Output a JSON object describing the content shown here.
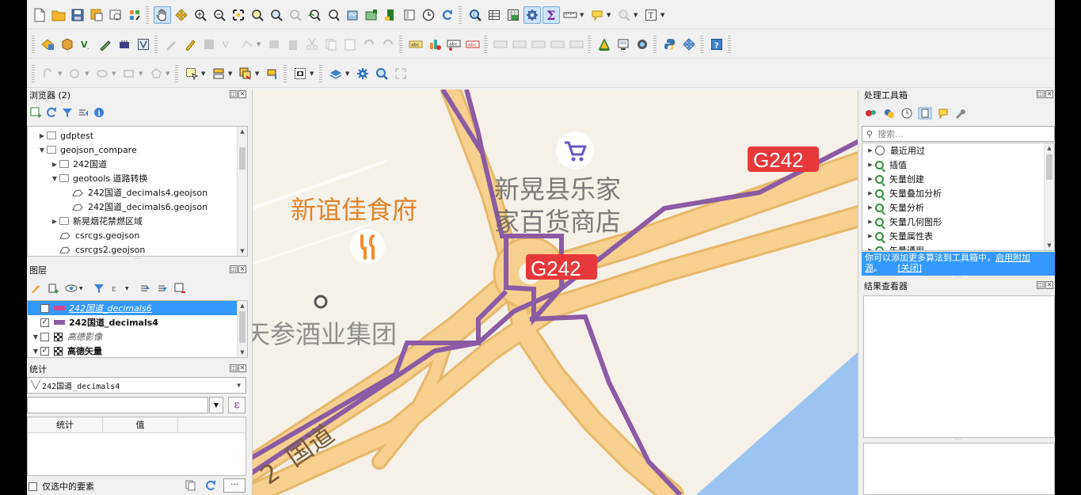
{
  "colors": {
    "accent": "#3399ff",
    "map_background": "#f5f1e8",
    "road": "#f3c985",
    "road_casing": "#e8b86a",
    "route": "#8c5ba3",
    "water": "#9cc4f2",
    "shield_red": "#e8393a",
    "poi_purple": "#6a55c8",
    "poi_orange": "#f28c28"
  },
  "toolbar_icons": {
    "row1": [
      "new-project-icon",
      "open-project-icon",
      "save-project-icon",
      "save-as-icon",
      "print-layout-icon",
      "style-manager-icon",
      "pan-icon",
      "pan-to-selection-icon",
      "zoom-in-icon",
      "zoom-out-icon",
      "zoom-full-icon",
      "zoom-to-selection-icon",
      "zoom-to-layer-icon",
      "zoom-native-icon",
      "zoom-last-icon",
      "zoom-next-icon",
      "new-bookmark-icon",
      "show-bookmarks-icon",
      "temporal-controller-icon",
      "new-map-view-icon",
      "time-icon",
      "refresh-icon",
      "identify-icon",
      "attribute-table-icon",
      "field-calculator-icon",
      "processing-toolbox-icon",
      "statistics-icon",
      "measure-icon",
      "annotation-icon",
      "map-tips-icon",
      "text-annotation-icon"
    ],
    "row2": [
      "data-source-manager-icon",
      "new-geopackage-icon",
      "new-shapefile-icon",
      "digitize-icon",
      "gps-icon",
      "virtual-layer-icon",
      "current-edits-icon",
      "toggle-editing-icon",
      "save-edits-icon",
      "add-feature-icon",
      "vertex-tool-icon",
      "modify-attributes-icon",
      "delete-selected-icon",
      "cut-icon",
      "copy-icon",
      "paste-icon",
      "undo-icon",
      "redo-icon",
      "label-icon",
      "diagram-icon",
      "pin-label-icon",
      "highlight-label-icon",
      "move-label-icon",
      "rotate-label-icon",
      "change-label-icon",
      "show-hide-labels-icon",
      "label-settings-icon",
      "georeferencer-icon",
      "metasearch-icon",
      "globe-icon",
      "python-console-icon",
      "plugin-icon",
      "help-icon"
    ],
    "row3": [
      "digitize-shape-icon",
      "add-circle-icon",
      "add-ellipse-icon",
      "add-rectangle-icon",
      "add-polygon-icon",
      "select-features-icon",
      "select-by-value-icon",
      "deselect-icon",
      "select-by-expression-icon",
      "screenshot-icon",
      "layer-style-icon",
      "settings-gear-icon",
      "locator-search-icon",
      "fullscreen-icon"
    ]
  },
  "browser": {
    "title": "浏览器 (2)",
    "items": [
      {
        "label": "gdptest",
        "type": "folder",
        "indent": 1,
        "expanded": false
      },
      {
        "label": "geojson_compare",
        "type": "folder",
        "indent": 1,
        "expanded": true
      },
      {
        "label": "242国道",
        "type": "folder",
        "indent": 2,
        "expanded": false
      },
      {
        "label": "geotools 道路转换",
        "type": "folder",
        "indent": 2,
        "expanded": true
      },
      {
        "label": "242国道_decimals4.geojson",
        "type": "geojson",
        "indent": 3
      },
      {
        "label": "242国道_decimals6.geojson",
        "type": "geojson",
        "indent": 3
      },
      {
        "label": "新晃烟花禁燃区域",
        "type": "folder",
        "indent": 2,
        "expanded": false
      },
      {
        "label": "csrcgs.geojson",
        "type": "geojson",
        "indent": 2
      },
      {
        "label": "csrcgs2.geojson",
        "type": "geojson",
        "indent": 2
      }
    ]
  },
  "layers": {
    "title": "图层",
    "items": [
      {
        "label": "242国道_decimals6",
        "checked": false,
        "swatch": "#d14a8f",
        "selected": true,
        "style": "italic-underline"
      },
      {
        "label": "242国道_decimals4",
        "checked": true,
        "swatch": "#8c5ba3",
        "selected": false,
        "style": "bold"
      },
      {
        "label": "高德影像",
        "checked": false,
        "swatch": "raster",
        "selected": false,
        "style": "italic-gray"
      },
      {
        "label": "高德矢量",
        "checked": true,
        "swatch": "raster",
        "selected": false,
        "style": "bold"
      }
    ]
  },
  "statistics": {
    "title": "统计",
    "layer_selected": "242国道_decimals4",
    "expression_placeholder": "",
    "col_stat": "统计",
    "col_value": "值",
    "only_selected": "仅选中的要素",
    "more_button": "···"
  },
  "map_labels": {
    "restaurant": "新谊佳食府",
    "store_line1": "新晃县乐家",
    "store_line2": "家百货商店",
    "company": "天参酒业集团",
    "road_number": "2",
    "road_name": "国道",
    "shield1": "G242",
    "shield2": "G242"
  },
  "toolbox": {
    "title": "处理工具箱",
    "search_placeholder": "搜索...",
    "items": [
      {
        "label": "最近用过",
        "icon": "clock-icon"
      },
      {
        "label": "插值",
        "icon": "qgis-icon"
      },
      {
        "label": "矢量创建",
        "icon": "qgis-icon"
      },
      {
        "label": "矢量叠加分析",
        "icon": "qgis-icon"
      },
      {
        "label": "矢量分析",
        "icon": "qgis-icon"
      },
      {
        "label": "矢量几何图形",
        "icon": "qgis-icon"
      },
      {
        "label": "矢量属性表",
        "icon": "qgis-icon"
      },
      {
        "label": "矢量通用",
        "icon": "qgis-icon"
      }
    ],
    "info_text": "你可以添加更多算法到工具箱中，",
    "info_link": "启用附加",
    "info_link2": "源",
    "info_sep": "。",
    "info_close": "[关闭]"
  },
  "results": {
    "title": "结果查看器"
  }
}
